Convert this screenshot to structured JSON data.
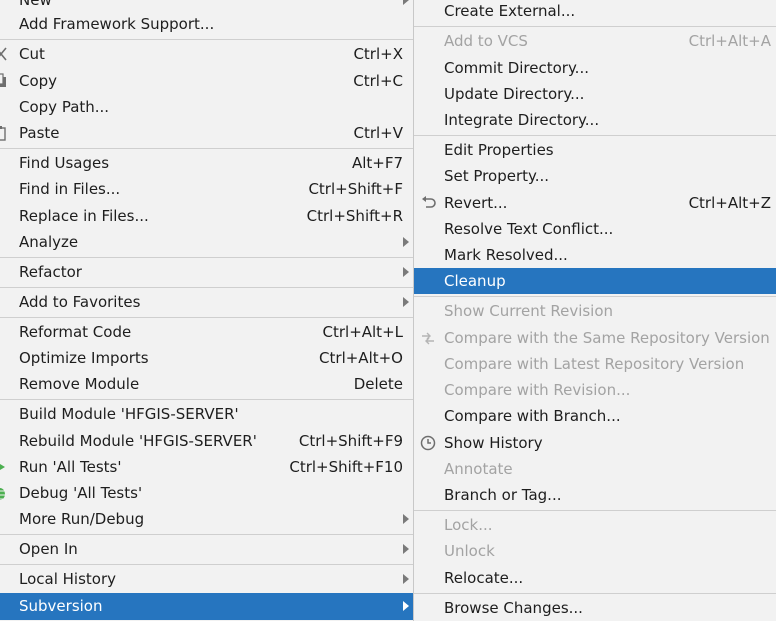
{
  "left_menu": {
    "new": "New",
    "add_framework_support": "Add Framework Support...",
    "cut": "Cut",
    "cut_shortcut": "Ctrl+X",
    "copy": "Copy",
    "copy_shortcut": "Ctrl+C",
    "copy_path": "Copy Path...",
    "paste": "Paste",
    "paste_shortcut": "Ctrl+V",
    "find_usages": "Find Usages",
    "find_usages_shortcut": "Alt+F7",
    "find_in_files": "Find in Files...",
    "find_in_files_shortcut": "Ctrl+Shift+F",
    "replace_in_files": "Replace in Files...",
    "replace_in_files_shortcut": "Ctrl+Shift+R",
    "analyze": "Analyze",
    "refactor": "Refactor",
    "add_to_favorites": "Add to Favorites",
    "reformat_code": "Reformat Code",
    "reformat_code_shortcut": "Ctrl+Alt+L",
    "optimize_imports": "Optimize Imports",
    "optimize_imports_shortcut": "Ctrl+Alt+O",
    "remove_module": "Remove Module",
    "remove_module_shortcut": "Delete",
    "build_module": "Build Module 'HFGIS-SERVER'",
    "rebuild_module": "Rebuild Module 'HFGIS-SERVER'",
    "rebuild_module_shortcut": "Ctrl+Shift+F9",
    "run_all_tests": "Run 'All Tests'",
    "run_all_tests_shortcut": "Ctrl+Shift+F10",
    "debug_all_tests": "Debug 'All Tests'",
    "more_run_debug": "More Run/Debug",
    "open_in": "Open In",
    "local_history": "Local History",
    "subversion": "Subversion"
  },
  "right_menu": {
    "create_external": "Create External...",
    "add_to_vcs": "Add to VCS",
    "add_to_vcs_shortcut": "Ctrl+Alt+A",
    "commit_directory": "Commit Directory...",
    "update_directory": "Update Directory...",
    "integrate_directory": "Integrate Directory...",
    "edit_properties": "Edit Properties",
    "set_property": "Set Property...",
    "revert": "Revert...",
    "revert_shortcut": "Ctrl+Alt+Z",
    "resolve_text_conflict": "Resolve Text Conflict...",
    "mark_resolved": "Mark Resolved...",
    "cleanup": "Cleanup",
    "show_current_revision": "Show Current Revision",
    "compare_same_repo": "Compare with the Same Repository Version",
    "compare_latest_repo": "Compare with Latest Repository Version",
    "compare_with_revision": "Compare with Revision...",
    "compare_with_branch": "Compare with Branch...",
    "show_history": "Show History",
    "annotate": "Annotate",
    "branch_or_tag": "Branch or Tag...",
    "lock": "Lock...",
    "unlock": "Unlock",
    "relocate": "Relocate...",
    "browse_changes": "Browse Changes..."
  },
  "colors": {
    "selection": "#2675bf",
    "menu_bg": "#f2f2f2",
    "disabled_text": "#a3a3a3",
    "run_icon": "#4caf50",
    "debug_icon": "#4caf50"
  },
  "icons": {
    "cut": "scissors-icon",
    "copy": "copy-icon",
    "paste": "paste-icon",
    "run": "run-icon",
    "debug": "debug-bug-icon",
    "revert": "revert-icon",
    "compare": "compare-icon",
    "history": "history-clock-icon",
    "submenu": "chevron-right-icon"
  }
}
